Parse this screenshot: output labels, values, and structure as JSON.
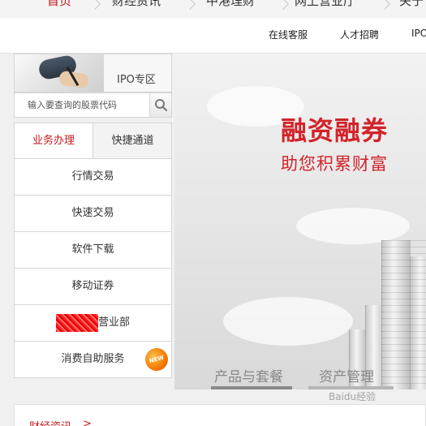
{
  "top_nav": {
    "tabs": [
      {
        "label": "首页",
        "active": true
      },
      {
        "label": "财经资讯",
        "active": false
      },
      {
        "label": "中港理财",
        "active": false
      },
      {
        "label": "网上营业厅",
        "active": false
      },
      {
        "label": "关于",
        "active": false
      }
    ]
  },
  "utility_bar": {
    "links": [
      "在线客服",
      "人才招聘",
      "IPO"
    ]
  },
  "sidebar": {
    "ipo_title": "IPO专区",
    "search": {
      "placeholder": "输入要查询的股票代码",
      "button_icon": "search-icon"
    },
    "tabs": [
      {
        "label": "业务办理",
        "active": true
      },
      {
        "label": "快捷通道",
        "active": false
      }
    ],
    "menu": [
      {
        "label": "行情交易"
      },
      {
        "label": "快速交易"
      },
      {
        "label": "软件下载"
      },
      {
        "label": "移动证券"
      },
      {
        "label": "营业部",
        "redacted_prefix": true
      },
      {
        "label": "消费自助服务",
        "badge": "NEW"
      }
    ]
  },
  "banner": {
    "headline": "融资融券",
    "subline": "助您积累财富",
    "tabs": [
      {
        "label": "产品与套餐",
        "active": true
      },
      {
        "label": "资产管理",
        "active": false
      }
    ]
  },
  "news": {
    "title": "财经资讯",
    "arrow": ">"
  },
  "watermark": "Baidu经验",
  "colors": {
    "accent": "#c21a1f",
    "banner_text": "#d2232a"
  }
}
